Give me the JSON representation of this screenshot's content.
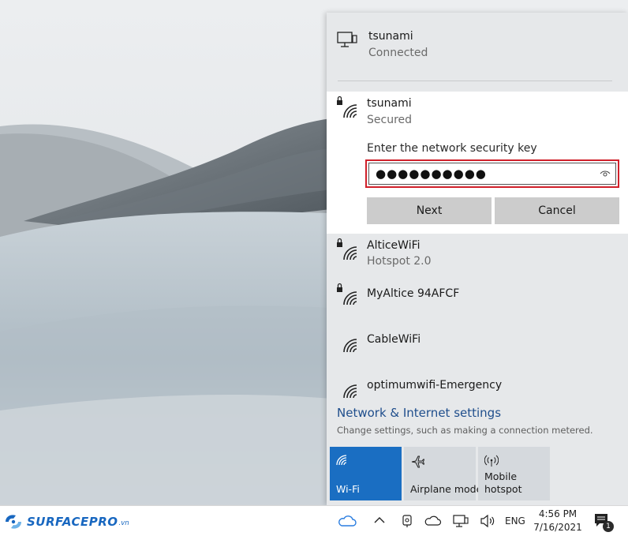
{
  "flyout": {
    "connected_network": {
      "name": "tsunami",
      "status": "Connected",
      "icon": "wired-monitor-icon"
    },
    "selected_network": {
      "name": "tsunami",
      "status": "Secured",
      "key_label": "Enter the network security key",
      "key_value": "●●●●●●●●●●",
      "next_label": "Next",
      "cancel_label": "Cancel"
    },
    "networks": [
      {
        "name": "AlticeWiFi",
        "status": "Hotspot 2.0",
        "secured": true
      },
      {
        "name": "MyAltice 94AFCF",
        "status": "",
        "secured": true
      },
      {
        "name": "CableWiFi",
        "status": "",
        "secured": false
      },
      {
        "name": "optimumwifi-Emergency",
        "status": "",
        "secured": false
      }
    ],
    "settings_link": "Network & Internet settings",
    "settings_desc": "Change settings, such as making a connection metered.",
    "quick_actions": [
      {
        "label": "Wi-Fi",
        "active": true,
        "icon": "wifi-icon"
      },
      {
        "label": "Airplane mode",
        "active": false,
        "icon": "airplane-icon"
      },
      {
        "label": "Mobile hotspot",
        "label_line1": "Mobile",
        "label_line2": "hotspot",
        "active": false,
        "icon": "hotspot-icon"
      }
    ]
  },
  "taskbar": {
    "brand": "SURFACEPRO",
    "brand_suffix": ".vn",
    "language": "ENG",
    "time": "4:56 PM",
    "date": "7/16/2021",
    "notification_count": "1"
  },
  "colors": {
    "accent": "#1a6ec2",
    "error_border": "#d0202a",
    "link": "#1f4e8c",
    "brand": "#1867c0"
  }
}
